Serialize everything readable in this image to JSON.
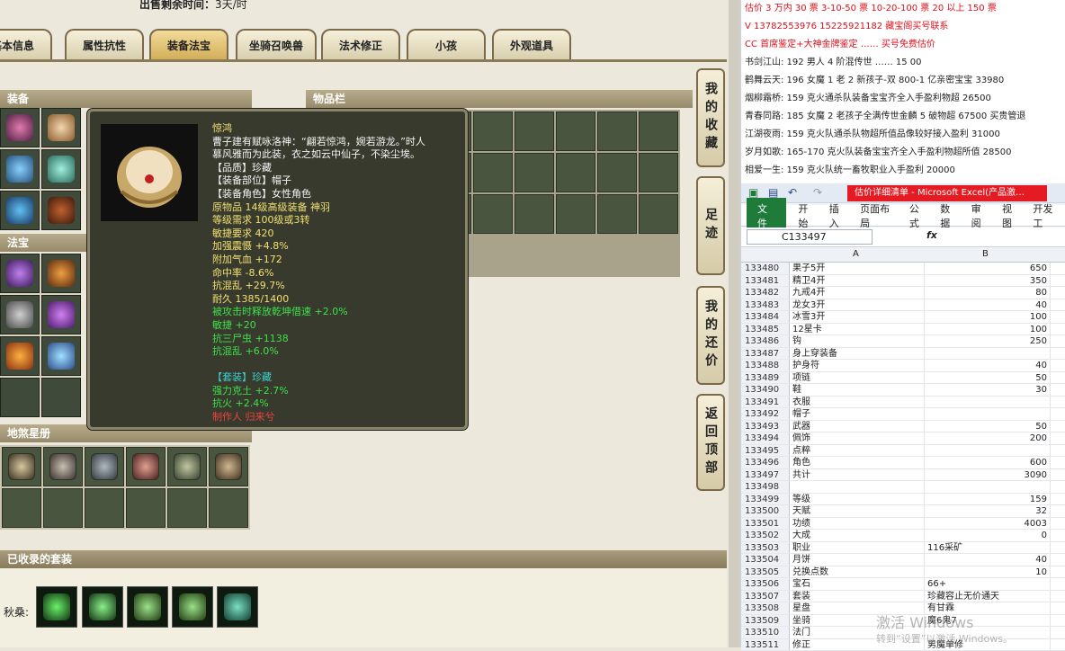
{
  "game": {
    "sale_time_label": "出售剩余时间：",
    "sale_time_value": "3天/时",
    "tabs": [
      "基本信息",
      "属性抗性",
      "装备法宝",
      "坐骑召唤兽",
      "法术修正",
      "小孩",
      "外观道具"
    ],
    "active_tab": "装备法宝",
    "sections": {
      "equip": "装备",
      "treasure": "法宝",
      "inventory": "物品栏",
      "pets": "地煞星册",
      "suits": "已收录的套装"
    },
    "side_buttons": [
      "我的收藏",
      "足迹",
      "我的还价",
      "返回顶部"
    ],
    "suit_label": "秋桑:",
    "tooltip": {
      "name": "惊鸿",
      "desc1": "曹子建有赋咏洛神：“翩若惊鸿，婉若游龙。”时人",
      "desc2": "慕风雅而为此装，衣之如云中仙子，不染尘埃。",
      "lines": [
        {
          "t": "【品质】珍藏",
          "c": "w"
        },
        {
          "t": "【装备部位】帽子",
          "c": "w"
        },
        {
          "t": "【装备角色】女性角色",
          "c": "w"
        },
        {
          "t": "原物品 14级高级装备 神羽",
          "c": "y"
        },
        {
          "t": "等级需求 100级或3转",
          "c": "y"
        },
        {
          "t": "敏捷要求 420",
          "c": "y"
        },
        {
          "t": "加强震慑 +4.8%",
          "c": "y"
        },
        {
          "t": "附加气血 +172",
          "c": "y"
        },
        {
          "t": "命中率 -8.6%",
          "c": "y"
        },
        {
          "t": "抗混乱 +29.7%",
          "c": "y"
        },
        {
          "t": "耐久 1385/1400",
          "c": "y"
        },
        {
          "t": "被攻击时释放乾坤借速 +2.0%",
          "c": "g"
        },
        {
          "t": "敏捷 +20",
          "c": "g"
        },
        {
          "t": "抗三尸虫 +1138",
          "c": "g"
        },
        {
          "t": "抗混乱 +6.0%",
          "c": "g"
        },
        {
          "t": "",
          "c": "w"
        },
        {
          "t": "【套装】珍藏",
          "c": "c"
        },
        {
          "t": "强力克土 +2.7%",
          "c": "g"
        },
        {
          "t": "抗火 +2.4%",
          "c": "g"
        },
        {
          "t": "制作人 归来兮",
          "c": "r"
        }
      ]
    }
  },
  "notes": [
    {
      "t": "估价 3 万内 30 票   3-10-50 票   10-20-100 票   20 以上 150 票",
      "red": true
    },
    {
      "t": "V 13782553976   15225921182  藏宝阁买号联系",
      "red": true
    },
    {
      "t": "CC 首席鉴定+大神金牌鉴定  ……  买号免费估价",
      "red": true
    },
    {
      "t": "书剑江山: 192 男人 4 阶混传世 …… 15 00",
      "red": false
    },
    {
      "t": "鹤舞云天: 196 女魔 1 老 2 新孩子-双 800-1 亿亲密宝宝 33980",
      "red": false
    },
    {
      "t": "烟柳霜桥: 159 克火通杀队装备宝宝齐全入手盈利物超 26500",
      "red": false
    },
    {
      "t": "青春同路: 185 女魔 2 老孩子全满传世金麟 5 破物超 67500 买贵管退",
      "red": false
    },
    {
      "t": "江湖夜雨: 159 克火队通杀队物超所值品像较好接入盈利 31000",
      "red": false
    },
    {
      "t": "岁月如歌: 165-170 克火队装备宝宝齐全入手盈利物超所值 28500",
      "red": false
    },
    {
      "t": "相爱一生: 159 克火队统一畜牧职业入手盈利 20000",
      "red": false
    }
  ],
  "excel": {
    "title": "估价详细清单 - Microsoft Excel(产品激…",
    "ribbon": [
      "文件",
      "开始",
      "插入",
      "页面布局",
      "公式",
      "数据",
      "审阅",
      "视图",
      "开发工"
    ],
    "namebox": "C133497",
    "fx": "fx",
    "cols": [
      "A",
      "B"
    ],
    "rows": [
      {
        "n": "133480",
        "a": "果子5开",
        "b": "650"
      },
      {
        "n": "133481",
        "a": "精卫4开",
        "b": "350"
      },
      {
        "n": "133482",
        "a": "九戒4开",
        "b": "80"
      },
      {
        "n": "133483",
        "a": "龙女3开",
        "b": "40"
      },
      {
        "n": "133484",
        "a": "冰雪3开",
        "b": "100"
      },
      {
        "n": "133485",
        "a": "12星卡",
        "b": "100"
      },
      {
        "n": "133486",
        "a": "钩",
        "b": "250"
      },
      {
        "n": "133487",
        "a": "身上穿装备",
        "b": ""
      },
      {
        "n": "133488",
        "a": "护身符",
        "b": "40"
      },
      {
        "n": "133489",
        "a": "项链",
        "b": "50"
      },
      {
        "n": "133490",
        "a": "鞋",
        "b": "30"
      },
      {
        "n": "133491",
        "a": "衣服",
        "b": ""
      },
      {
        "n": "133492",
        "a": "帽子",
        "b": ""
      },
      {
        "n": "133493",
        "a": "武器",
        "b": "50"
      },
      {
        "n": "133494",
        "a": "佩饰",
        "b": "200"
      },
      {
        "n": "133495",
        "a": "点粹",
        "b": ""
      },
      {
        "n": "133496",
        "a": "角色",
        "b": "600"
      },
      {
        "n": "133497",
        "a": "共计",
        "b": "3090"
      },
      {
        "n": "133498",
        "a": "",
        "b": ""
      },
      {
        "n": "133499",
        "a": "等级",
        "b": "159"
      },
      {
        "n": "133500",
        "a": "天赋",
        "b": "32"
      },
      {
        "n": "133501",
        "a": "功绩",
        "b": "4003"
      },
      {
        "n": "133502",
        "a": "大成",
        "b": "0"
      },
      {
        "n": "133503",
        "a": "职业",
        "b": "116采矿",
        "t": true
      },
      {
        "n": "133504",
        "a": "月饼",
        "b": "40"
      },
      {
        "n": "133505",
        "a": "兑换点数",
        "b": "10"
      },
      {
        "n": "133506",
        "a": "宝石",
        "b": "66+",
        "t": true
      },
      {
        "n": "133507",
        "a": "套装",
        "b": "珍藏容止无价通天",
        "t": true
      },
      {
        "n": "133508",
        "a": "星盘",
        "b": "有甘霖",
        "t": true
      },
      {
        "n": "133509",
        "a": "坐骑",
        "b": "魔6鬼7",
        "t": true
      },
      {
        "n": "133510",
        "a": "法门",
        "b": "",
        "t": true
      },
      {
        "n": "133511",
        "a": "修正",
        "b": "男魔单修",
        "t": true
      }
    ],
    "watermark1": "激活 Windows",
    "watermark2": "转到“设置”以激活 Windows。"
  },
  "colors": {
    "accent": "#d2ae5a",
    "note_red": "#e0101a",
    "excel_title": "#e41b23",
    "excel_file": "#1e7b3a"
  }
}
